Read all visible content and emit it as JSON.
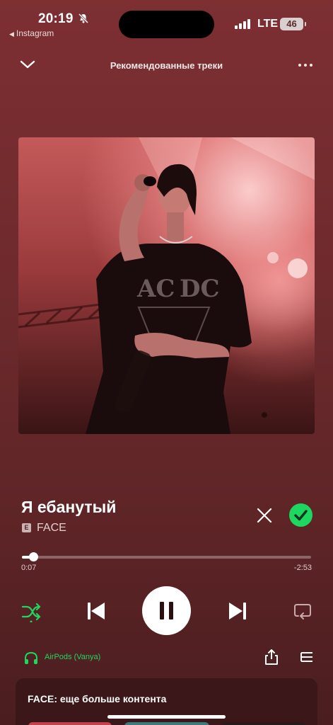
{
  "status_bar": {
    "time": "20:19",
    "back_app": "Instagram",
    "network": "LTE",
    "battery": "46",
    "icons": [
      "bell-off-icon",
      "signal-icon",
      "battery-icon"
    ]
  },
  "header": {
    "title": "Рекомендованные треки",
    "icons": [
      "chevron-down-icon",
      "more-icon"
    ]
  },
  "track": {
    "title": "Я ебанутый",
    "explicit_badge": "E",
    "artist": "FACE",
    "liked": true
  },
  "progress": {
    "elapsed": "0:07",
    "remaining": "-2:53",
    "fraction": 0.039
  },
  "controls": {
    "icons": [
      "shuffle-icon",
      "previous-icon",
      "pause-icon",
      "next-icon",
      "repeat-icon"
    ],
    "shuffle_on": true,
    "playing": true
  },
  "device": {
    "label": "AirPods (Vanya)",
    "icons": [
      "headphones-icon",
      "share-icon",
      "queue-icon"
    ]
  },
  "card": {
    "title": "FACE: еще больше контента"
  },
  "colors": {
    "background": "#6e2a2d",
    "accent_green": "#1ed760",
    "card": "#3b1719"
  }
}
